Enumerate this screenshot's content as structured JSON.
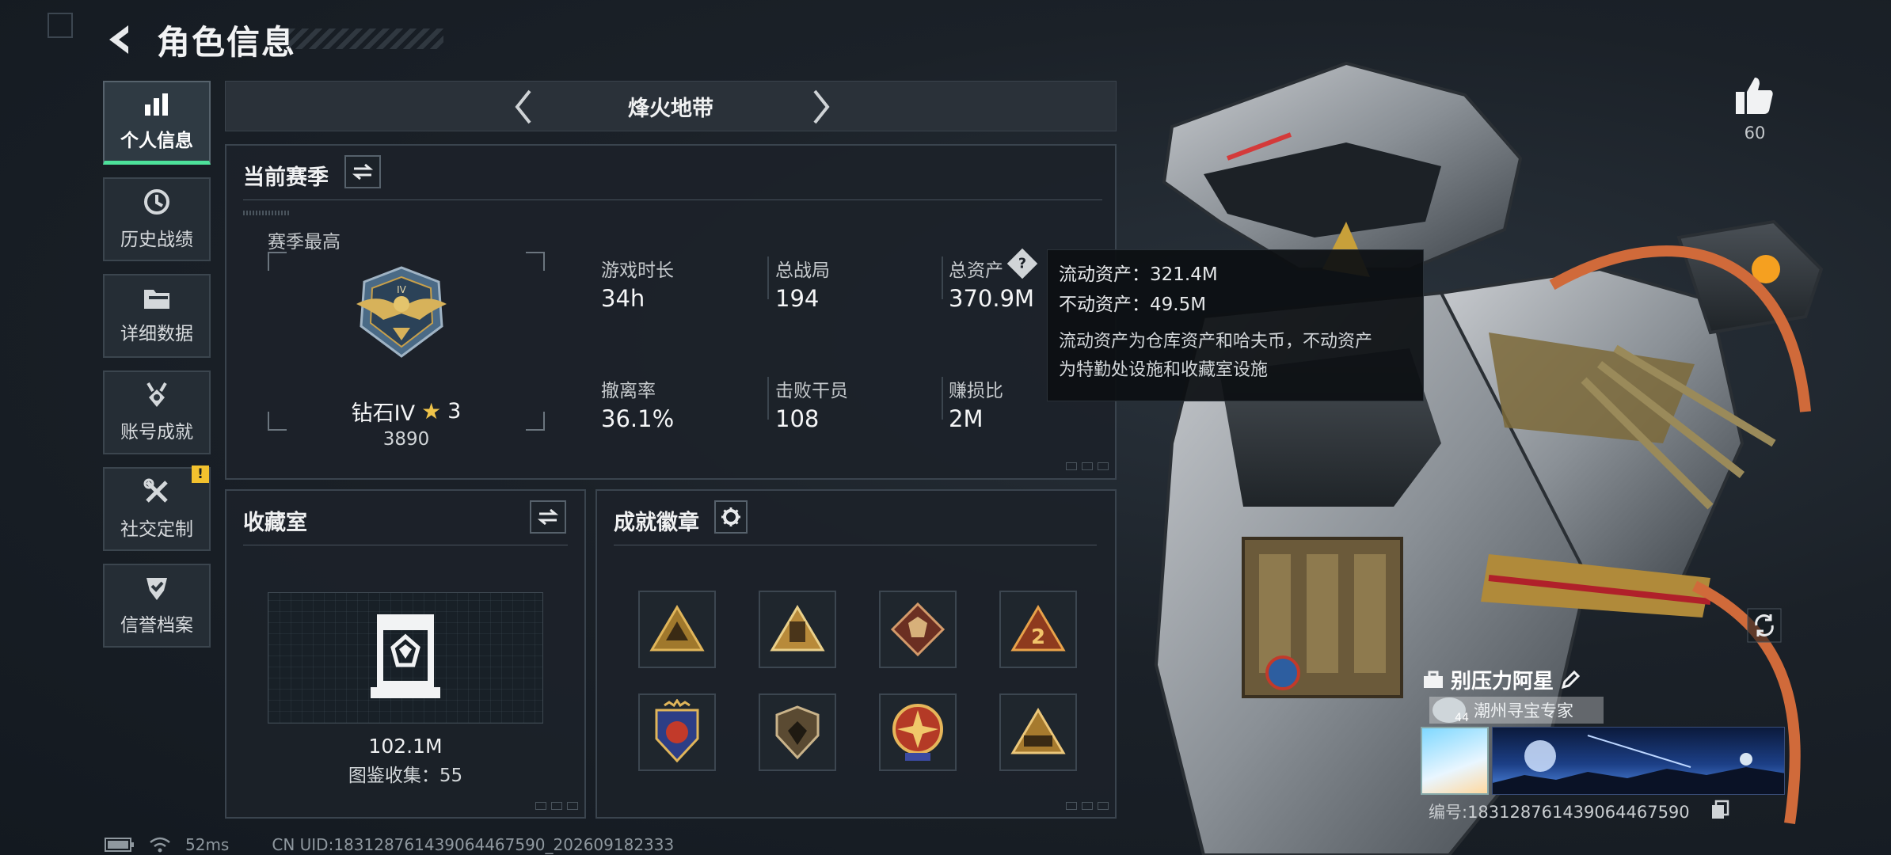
{
  "header": {
    "title": "角色信息"
  },
  "sidebar": {
    "items": [
      {
        "label": "个人信息",
        "icon": "bar-chart-icon",
        "active": true
      },
      {
        "label": "历史战绩",
        "icon": "clock-icon"
      },
      {
        "label": "详细数据",
        "icon": "folder-icon"
      },
      {
        "label": "账号成就",
        "icon": "medal-icon"
      },
      {
        "label": "社交定制",
        "icon": "tools-icon",
        "badge": "!"
      },
      {
        "label": "信誉档案",
        "icon": "shield-check-icon"
      }
    ]
  },
  "mode": {
    "name": "烽火地带"
  },
  "season": {
    "title": "当前赛季",
    "highest_label": "赛季最高",
    "rank_name": "钻石IV",
    "rank_stars": "3",
    "rank_points": "3890",
    "stats": [
      {
        "label": "游戏时长",
        "value": "34h"
      },
      {
        "label": "总战局",
        "value": "194"
      },
      {
        "label": "总资产",
        "value": "370.9M",
        "help": "?"
      },
      {
        "label": "撤离率",
        "value": "36.1%"
      },
      {
        "label": "击败干员",
        "value": "108"
      },
      {
        "label": "赚损比",
        "value": "2M"
      }
    ]
  },
  "tooltip": {
    "liquid": "流动资产：321.4M",
    "fixed": "不动资产：49.5M",
    "note_line1": "流动资产为仓库资产和哈夫币，不动资产",
    "note_line2": "为特勤处设施和收藏室设施"
  },
  "collection": {
    "title": "收藏室",
    "value": "102.1M",
    "codex": "图鉴收集：55"
  },
  "achievements": {
    "title": "成就徽章",
    "badges": [
      "triangle-badge-icon",
      "tower-badge-icon",
      "wolf-badge-icon",
      "number-two-badge-icon",
      "star-crest-badge-icon",
      "shield-badge-icon",
      "compass-badge-icon",
      "stii-badge-icon"
    ]
  },
  "profile": {
    "likes": "60",
    "player_name": "别压力阿星",
    "title_chip": "潮州寻宝专家",
    "level": "44",
    "uid": "编号:18312876143906446759​0"
  },
  "status_bar": {
    "ping": "52ms",
    "client_uid": "CN UID:18312876143906446759​0_202609182333"
  },
  "colors": {
    "accent": "#4de19a",
    "warning": "#f2c12e",
    "panel_bg": "#1c2229"
  }
}
